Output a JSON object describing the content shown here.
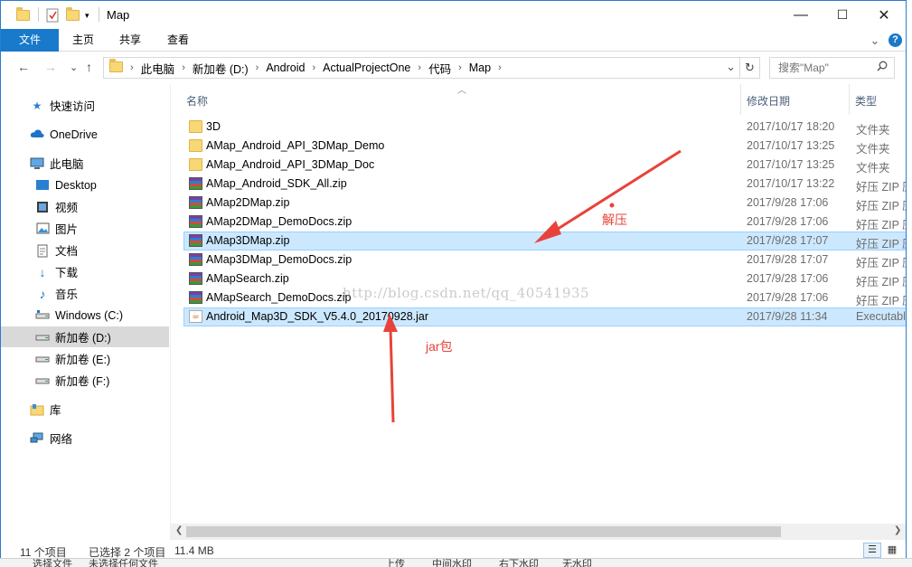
{
  "window": {
    "title": "Map",
    "controls": {
      "minimize": "—",
      "maximize": "☐",
      "close": "✕"
    }
  },
  "ribbon": {
    "tabs": [
      "文件",
      "主页",
      "共享",
      "查看"
    ],
    "expand_glyph": "⌄",
    "help_glyph": "?"
  },
  "address": {
    "crumbs": [
      "此电脑",
      "新加卷 (D:)",
      "Android",
      "ActualProjectOne",
      "代码",
      "Map"
    ],
    "separator": "›",
    "dropdown_glyph": "⌄",
    "refresh_glyph": "↻"
  },
  "search": {
    "placeholder": "搜索\"Map\""
  },
  "nav": {
    "back": "←",
    "forward": "→",
    "recent": "⌄",
    "up": "↑",
    "items": [
      {
        "label": "快速访问",
        "icon": "star-icon"
      },
      {
        "label": "OneDrive",
        "icon": "cloud-icon"
      },
      {
        "label": "此电脑",
        "icon": "computer-icon"
      },
      {
        "label": "Desktop",
        "icon": "desktop-icon"
      },
      {
        "label": "视频",
        "icon": "video-icon"
      },
      {
        "label": "图片",
        "icon": "picture-icon"
      },
      {
        "label": "文档",
        "icon": "document-icon"
      },
      {
        "label": "下载",
        "icon": "download-icon"
      },
      {
        "label": "音乐",
        "icon": "music-icon"
      },
      {
        "label": "Windows (C:)",
        "icon": "drive-icon"
      },
      {
        "label": "新加卷 (D:)",
        "icon": "drive-icon"
      },
      {
        "label": "新加卷 (E:)",
        "icon": "drive-icon"
      },
      {
        "label": "新加卷 (F:)",
        "icon": "drive-icon"
      },
      {
        "label": "库",
        "icon": "library-icon"
      },
      {
        "label": "网络",
        "icon": "network-icon"
      }
    ]
  },
  "columns": {
    "name": "名称",
    "date": "修改日期",
    "type": "类型"
  },
  "files": [
    {
      "name": "3D",
      "date": "2017/10/17 18:20",
      "type": "文件夹",
      "kind": "folder"
    },
    {
      "name": "AMap_Android_API_3DMap_Demo",
      "date": "2017/10/17 13:25",
      "type": "文件夹",
      "kind": "folder"
    },
    {
      "name": "AMap_Android_API_3DMap_Doc",
      "date": "2017/10/17 13:25",
      "type": "文件夹",
      "kind": "folder"
    },
    {
      "name": "AMap_Android_SDK_All.zip",
      "date": "2017/10/17 13:22",
      "type": "好压 ZIP 压",
      "kind": "zip"
    },
    {
      "name": "AMap2DMap.zip",
      "date": "2017/9/28 17:06",
      "type": "好压 ZIP 压",
      "kind": "zip"
    },
    {
      "name": "AMap2DMap_DemoDocs.zip",
      "date": "2017/9/28 17:06",
      "type": "好压 ZIP 压",
      "kind": "zip"
    },
    {
      "name": "AMap3DMap.zip",
      "date": "2017/9/28 17:07",
      "type": "好压 ZIP 压",
      "kind": "zip"
    },
    {
      "name": "AMap3DMap_DemoDocs.zip",
      "date": "2017/9/28 17:07",
      "type": "好压 ZIP 压",
      "kind": "zip"
    },
    {
      "name": "AMapSearch.zip",
      "date": "2017/9/28 17:06",
      "type": "好压 ZIP 压",
      "kind": "zip"
    },
    {
      "name": "AMapSearch_DemoDocs.zip",
      "date": "2017/9/28 17:06",
      "type": "好压 ZIP 压",
      "kind": "zip"
    },
    {
      "name": "Android_Map3D_SDK_V5.4.0_20170928.jar",
      "date": "2017/9/28 11:34",
      "type": "Executable",
      "kind": "jar"
    }
  ],
  "annotations": {
    "unzip": "解压",
    "jar": "jar包",
    "watermark": "http://blog.csdn.net/qq_40541935"
  },
  "status": {
    "count": "11 个项目",
    "selected": "已选择 2 个项目",
    "size": "11.4 MB"
  },
  "bottom_strip": [
    "选择文件",
    "未选择任何文件",
    "上传",
    "中间水印",
    "右下水印",
    "无水印"
  ],
  "colors": {
    "accent": "#1979ca",
    "selection": "#cce8ff",
    "annotation": "#e8433a"
  }
}
